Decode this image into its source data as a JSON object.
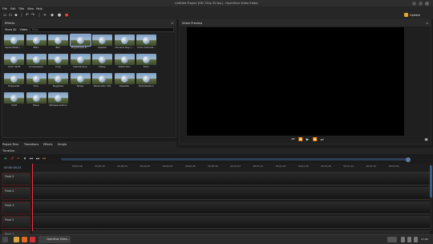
{
  "window": {
    "title": "Untitled Project [HD 720p 30 fps] - OpenShot Video Editor"
  },
  "menu": [
    "File",
    "Edit",
    "Title",
    "View",
    "Help"
  ],
  "toolbar": {
    "update_label": "Update Available"
  },
  "effects_panel": {
    "title": "Effects",
    "filters": [
      "Show All",
      "Video",
      "Audio"
    ],
    "filter_placeholder": "Filter",
    "items": [
      "Alpha Mask / ...",
      "Bars",
      "Blur",
      "Brightness &...",
      "Caption",
      "Chroma Key (...",
      "Color Saturat...",
      "Color Shift",
      "Compressor",
      "Crop",
      "Deinterlace",
      "Delay",
      "Distortion",
      "Echo",
      "Expander",
      "Hue",
      "Negative",
      "Noise",
      "Parametric EQ",
      "Pixelate",
      "Robotization",
      "Shift",
      "Wave",
      "Whisperization"
    ]
  },
  "preview_panel": {
    "title": "Video Preview"
  },
  "tabs": [
    "Project Files",
    "Transitions",
    "Effects",
    "Emojis"
  ],
  "timeline": {
    "title": "Timeline",
    "timecode": "00:00:00,01",
    "ticks": [
      "00:00:08",
      "00:00:16",
      "00:00:24",
      "00:00:32",
      "00:00:40",
      "00:00:48",
      "00:00:56",
      "00:01:04",
      "00:01:12",
      "00:01:20",
      "00:01:28",
      "00:01:36",
      "00:01:44",
      "00:01:52",
      "00:02:00"
    ],
    "tracks": [
      "Track 5",
      "Track 4",
      "Track 3",
      "Track 2",
      "Track 1"
    ]
  },
  "taskbar": {
    "app_label": "OpenShot Video...",
    "clock": "17:08"
  }
}
